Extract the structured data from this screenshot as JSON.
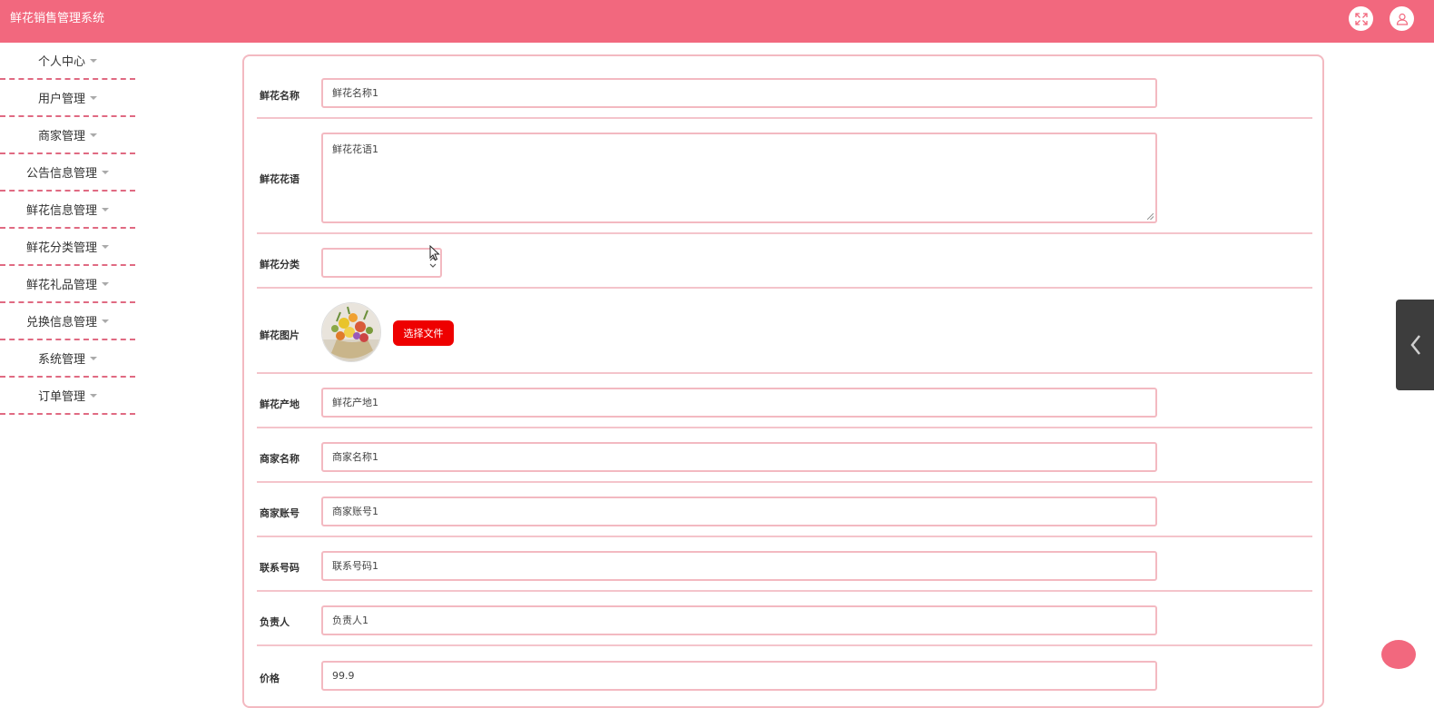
{
  "app": {
    "title": "鲜花销售管理系统"
  },
  "header": {
    "fullscreen_icon": "expand-icon",
    "user_icon": "user-icon"
  },
  "sidebar": {
    "items": [
      {
        "label": "个人中心"
      },
      {
        "label": "用户管理"
      },
      {
        "label": "商家管理"
      },
      {
        "label": "公告信息管理"
      },
      {
        "label": "鲜花信息管理"
      },
      {
        "label": "鲜花分类管理"
      },
      {
        "label": "鲜花礼品管理"
      },
      {
        "label": "兑换信息管理"
      },
      {
        "label": "系统管理"
      },
      {
        "label": "订单管理"
      }
    ]
  },
  "form": {
    "name": {
      "label": "鲜花名称",
      "value": "鲜花名称1"
    },
    "language": {
      "label": "鲜花花语",
      "value": "鲜花花语1"
    },
    "category": {
      "label": "鲜花分类",
      "value": ""
    },
    "image": {
      "label": "鲜花图片",
      "button": "选择文件"
    },
    "origin": {
      "label": "鲜花产地",
      "value": "鲜花产地1"
    },
    "merchant_name": {
      "label": "商家名称",
      "value": "商家名称1"
    },
    "merchant_account": {
      "label": "商家账号",
      "value": "商家账号1"
    },
    "phone": {
      "label": "联系号码",
      "value": "联系号码1"
    },
    "manager": {
      "label": "负责人",
      "value": "负责人1"
    },
    "price": {
      "label": "价格",
      "value": "99.9"
    }
  },
  "colors": {
    "header": "#f2687e",
    "border": "#f3b9c1",
    "file_button": "#ee0000",
    "side_tab": "#3d3d3d"
  }
}
